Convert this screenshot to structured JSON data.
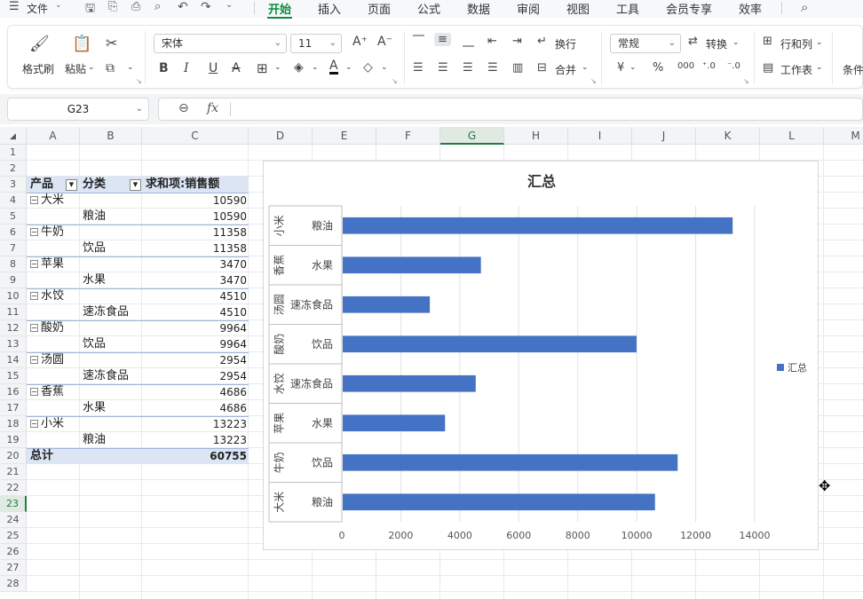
{
  "menubar": {
    "file_label": "文件",
    "tabs": [
      "开始",
      "插入",
      "页面",
      "公式",
      "数据",
      "审阅",
      "视图",
      "工具",
      "会员专享",
      "效率"
    ]
  },
  "ribbon": {
    "format_painter": "格式刷",
    "paste": "粘贴",
    "font_name": "宋体",
    "font_size": "11",
    "wrap": "换行",
    "merge": "合并",
    "number_format": "常规",
    "convert": "转换",
    "rows_cols": "行和列",
    "worksheet": "工作表",
    "cond": "条件"
  },
  "formula": {
    "namebox": "G23",
    "fx": "fx",
    "content": ""
  },
  "grid": {
    "columns": [
      "A",
      "B",
      "C",
      "D",
      "E",
      "F",
      "G",
      "H",
      "I",
      "J",
      "K",
      "L",
      "M"
    ],
    "selected_column": "G",
    "rows": [
      "1",
      "2",
      "3",
      "4",
      "5",
      "6",
      "7",
      "8",
      "9",
      "10",
      "11",
      "12",
      "13",
      "14",
      "15",
      "16",
      "17",
      "18",
      "19",
      "20",
      "21",
      "22",
      "23",
      "24",
      "25",
      "26",
      "27",
      "28"
    ],
    "selected_row": "23"
  },
  "pivot": {
    "header_product": "产品",
    "header_category": "分类",
    "header_sum": "求和项:销售额",
    "rows": [
      {
        "a": "大米",
        "b": "",
        "c": "10590",
        "exp": true
      },
      {
        "a": "",
        "b": "粮油",
        "c": "10590",
        "exp": false
      },
      {
        "a": "牛奶",
        "b": "",
        "c": "11358",
        "exp": true
      },
      {
        "a": "",
        "b": "饮品",
        "c": "11358",
        "exp": false
      },
      {
        "a": "苹果",
        "b": "",
        "c": "3470",
        "exp": true
      },
      {
        "a": "",
        "b": "水果",
        "c": "3470",
        "exp": false
      },
      {
        "a": "水饺",
        "b": "",
        "c": "4510",
        "exp": true
      },
      {
        "a": "",
        "b": "速冻食品",
        "c": "4510",
        "exp": false
      },
      {
        "a": "酸奶",
        "b": "",
        "c": "9964",
        "exp": true
      },
      {
        "a": "",
        "b": "饮品",
        "c": "9964",
        "exp": false
      },
      {
        "a": "汤圆",
        "b": "",
        "c": "2954",
        "exp": true
      },
      {
        "a": "",
        "b": "速冻食品",
        "c": "2954",
        "exp": false
      },
      {
        "a": "香蕉",
        "b": "",
        "c": "4686",
        "exp": true
      },
      {
        "a": "",
        "b": "水果",
        "c": "4686",
        "exp": false
      },
      {
        "a": "小米",
        "b": "",
        "c": "13223",
        "exp": true
      },
      {
        "a": "",
        "b": "粮油",
        "c": "13223",
        "exp": false
      }
    ],
    "total_label": "总计",
    "total_value": "60755"
  },
  "chart_data": {
    "type": "bar",
    "orientation": "horizontal",
    "title": "汇总",
    "categories": [
      {
        "group": "大米",
        "sub": "粮油"
      },
      {
        "group": "牛奶",
        "sub": "饮品"
      },
      {
        "group": "苹果",
        "sub": "水果"
      },
      {
        "group": "水饺",
        "sub": "速冻食品"
      },
      {
        "group": "酸奶",
        "sub": "饮品"
      },
      {
        "group": "汤圆",
        "sub": "速冻食品"
      },
      {
        "group": "香蕉",
        "sub": "水果"
      },
      {
        "group": "小米",
        "sub": "粮油"
      }
    ],
    "series": [
      {
        "name": "汇总",
        "values": [
          10590,
          11358,
          3470,
          4510,
          9964,
          2954,
          4686,
          13223
        ]
      }
    ],
    "xlim": [
      0,
      14000
    ],
    "xticks": [
      "0",
      "2000",
      "4000",
      "6000",
      "8000",
      "10000",
      "12000",
      "14000"
    ],
    "grid": true,
    "legend": "right",
    "bar_color": "#4472c4"
  }
}
